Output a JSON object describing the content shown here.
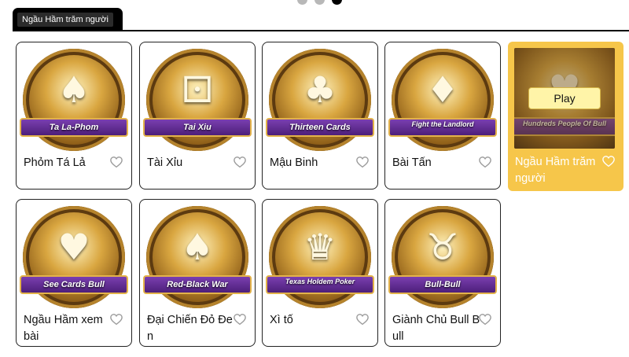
{
  "carousel": {
    "pages": 3,
    "active_page": 3
  },
  "tab": {
    "label": "Ngầu Hầm trăm người"
  },
  "games": [
    {
      "title": "Phỏm Tá Lả",
      "banner": "Ta La-Phom",
      "art": "♠",
      "icon": "heart-outline-icon"
    },
    {
      "title": "Tài Xỉu",
      "banner": "Tai Xiu",
      "art": "⚀",
      "icon": "heart-outline-icon"
    },
    {
      "title": "Mậu Binh",
      "banner": "Thirteen Cards",
      "art": "♣",
      "icon": "heart-outline-icon"
    },
    {
      "title": "Bài Tấn",
      "banner": "Fight the Landlord",
      "art": "♦",
      "icon": "heart-outline-icon"
    },
    {
      "title": "Ngầu Hầm trăm người",
      "banner": "Hundreds People Of Bull",
      "art": "♥",
      "play_label": "Play",
      "icon": "heart-outline-icon",
      "highlight_color": "#f6c64a"
    },
    {
      "title": "Ngầu Hầm xem bài",
      "banner": "See Cards Bull",
      "art": "♥",
      "icon": "heart-outline-icon"
    },
    {
      "title": "Đại Chiến Đỏ Đen",
      "banner": "Red-Black War",
      "art": "♠",
      "icon": "heart-outline-icon"
    },
    {
      "title": "Xì tố",
      "banner": "Texas Holdem Poker",
      "art": "♛",
      "icon": "heart-outline-icon"
    },
    {
      "title": "Giành Chủ Bull Bull",
      "banner": "Bull-Bull",
      "art": "♉",
      "icon": "heart-outline-icon"
    }
  ]
}
